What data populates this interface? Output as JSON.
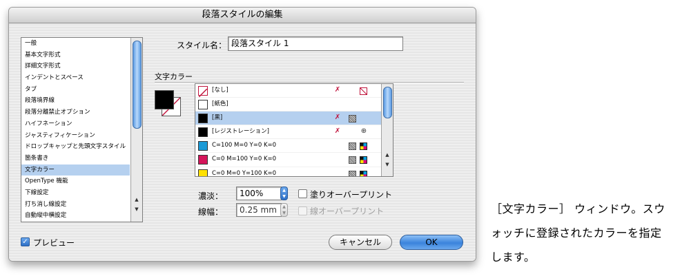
{
  "dialog": {
    "title": "段落スタイルの編集",
    "categories": [
      {
        "label": "一般",
        "selected": false
      },
      {
        "label": "基本文字形式",
        "selected": false
      },
      {
        "label": "詳細文字形式",
        "selected": false
      },
      {
        "label": "インデントとスペース",
        "selected": false
      },
      {
        "label": "タブ",
        "selected": false
      },
      {
        "label": "段落境界線",
        "selected": false
      },
      {
        "label": "段落分離禁止オプション",
        "selected": false
      },
      {
        "label": "ハイフネーション",
        "selected": false
      },
      {
        "label": "ジャスティフィケーション",
        "selected": false
      },
      {
        "label": "ドロップキャップと先頭文字スタイル",
        "selected": false
      },
      {
        "label": "箇条書き",
        "selected": false
      },
      {
        "label": "文字カラー",
        "selected": true
      },
      {
        "label": "OpenType 機能",
        "selected": false
      },
      {
        "label": "下線設定",
        "selected": false
      },
      {
        "label": "打ち消し線設定",
        "selected": false
      },
      {
        "label": "自動縦中横設定",
        "selected": false
      }
    ],
    "style_name_label": "スタイル名：",
    "style_name_value": "段落スタイル 1",
    "section_title": "文字カラー",
    "swatches": [
      {
        "name": "[なし]",
        "color": "#ffffff",
        "chip": "none",
        "icons": [
          "no-edit-icon",
          "none-swatch-icon"
        ],
        "selected": false
      },
      {
        "name": "[紙色]",
        "color": "#ffffff",
        "chip": "solid",
        "icons": [],
        "selected": false
      },
      {
        "name": "[黒]",
        "color": "#000000",
        "chip": "solid",
        "icons": [
          "no-edit-icon",
          "process-type-icon"
        ],
        "selected": true
      },
      {
        "name": "[レジストレーション]",
        "color": "#000000",
        "chip": "solid",
        "icons": [
          "no-edit-icon",
          "registration-icon"
        ],
        "selected": false
      },
      {
        "name": "C=100 M=0 Y=0 K=0",
        "color": "#1b9ad6",
        "chip": "solid",
        "icons": [
          "process-type-icon",
          "cmyk-mode-icon"
        ],
        "selected": false
      },
      {
        "name": "C=0 M=100 Y=0 K=0",
        "color": "#d4145a",
        "chip": "solid",
        "icons": [
          "process-type-icon",
          "cmyk-mode-icon"
        ],
        "selected": false
      },
      {
        "name": "C=0 M=0 Y=100 K=0",
        "color": "#ffe100",
        "chip": "solid",
        "icons": [
          "process-type-icon",
          "cmyk-mode-icon"
        ],
        "selected": false
      }
    ],
    "tint_label": "濃淡：",
    "tint_value": "100%",
    "overprint_fill_label": "塗りオーバープリント",
    "weight_label": "線幅：",
    "weight_value": "0.25 mm",
    "overprint_stroke_label": "線オーバープリント",
    "preview_label": "プレビュー",
    "preview_checked": true,
    "cancel_label": "キャンセル",
    "ok_label": "OK"
  },
  "caption": {
    "lines": [
      "［文字カラー］ ウィンドウ。スウ",
      "ォッチに登録されたカラーを指定",
      "します。"
    ]
  }
}
